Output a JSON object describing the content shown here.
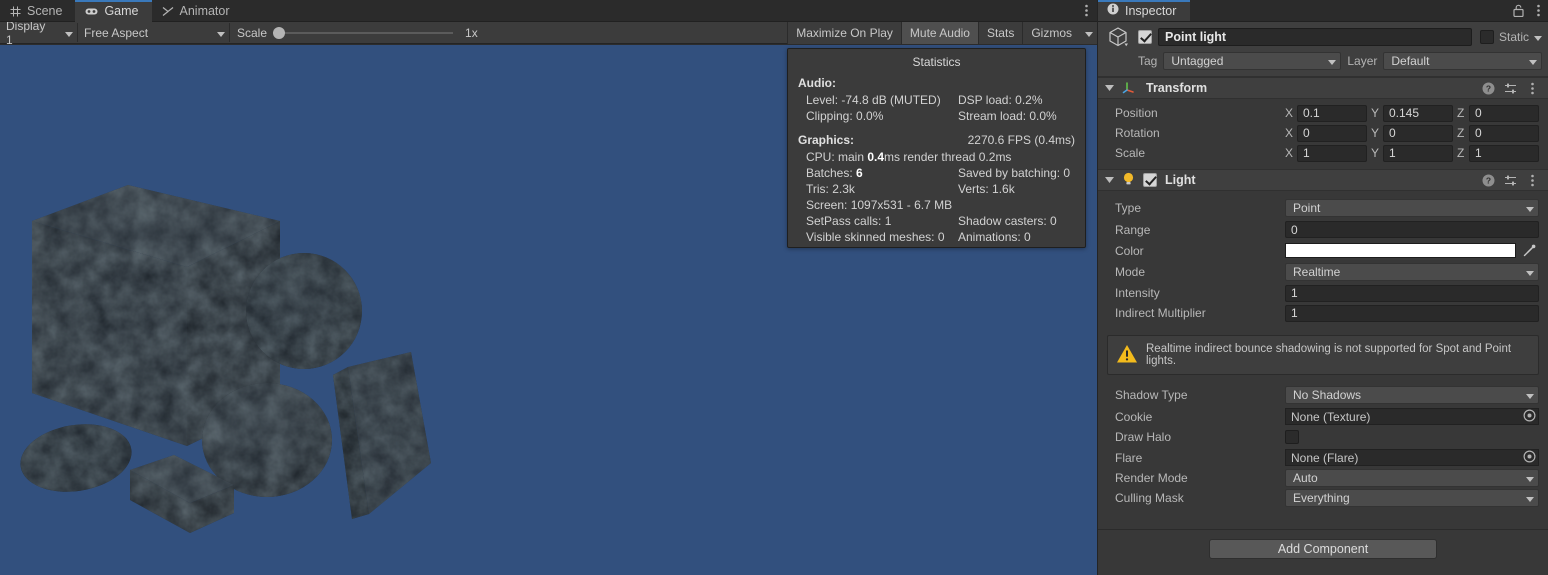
{
  "gameview": {
    "tabs": [
      {
        "label": "Scene",
        "icon": "grid-icon",
        "active": false
      },
      {
        "label": "Game",
        "icon": "gamepad-icon",
        "active": true
      },
      {
        "label": "Animator",
        "icon": "animator-icon",
        "active": false
      }
    ],
    "tabbar_menu_icon": "kebab-menu-icon",
    "toolbar": {
      "display": "Display 1",
      "aspect": "Free Aspect",
      "scale_label": "Scale",
      "scale_value": "1x",
      "maximize_on_play": "Maximize On Play",
      "mute_audio": "Mute Audio",
      "stats": "Stats",
      "gizmos": "Gizmos"
    },
    "background_color": "#32507e"
  },
  "statistics": {
    "title": "Statistics",
    "audio_header": "Audio:",
    "audio_rows": [
      {
        "left": "Level: -74.8 dB (MUTED)",
        "right": "DSP load: 0.2%"
      },
      {
        "left": "Clipping: 0.0%",
        "right": "Stream load: 0.0%"
      }
    ],
    "graphics_header": "Graphics:",
    "fps": "2270.6 FPS (0.4ms)",
    "cpu_prefix": "CPU: main ",
    "cpu_bold": "0.4",
    "cpu_suffix": "ms  render thread 0.2ms",
    "batches_prefix": "Batches: ",
    "batches_bold": "6",
    "saved_by_batching": "Saved by batching: 0",
    "tris": "Tris: 2.3k",
    "verts": "Verts: 1.6k",
    "screen": "Screen: 1097x531 - 6.7 MB",
    "setpass": "SetPass calls: 1",
    "shadow_casters": "Shadow casters: 0",
    "skinned_meshes": "Visible skinned meshes: 0",
    "animations": "Animations: 0"
  },
  "inspector": {
    "tab_label": "Inspector",
    "tab_icon": "info-icon",
    "lock_icon": "lock-icon",
    "menu_icon": "kebab-menu-icon",
    "object": {
      "icon": "gameobject-cube-icon",
      "enabled": true,
      "name": "Point light",
      "static_label": "Static",
      "static_checked": false,
      "tag_label": "Tag",
      "tag_value": "Untagged",
      "layer_label": "Layer",
      "layer_value": "Default"
    },
    "transform": {
      "title": "Transform",
      "icon": "transform-axis-icon",
      "rows": [
        {
          "label": "Position",
          "x": "0.1",
          "y": "0.145",
          "z": "0"
        },
        {
          "label": "Rotation",
          "x": "0",
          "y": "0",
          "z": "0"
        },
        {
          "label": "Scale",
          "x": "1",
          "y": "1",
          "z": "1"
        }
      ],
      "axis_labels": {
        "x": "X",
        "y": "Y",
        "z": "Z"
      }
    },
    "light": {
      "title": "Light",
      "icon": "lightbulb-icon",
      "enabled": true,
      "type_label": "Type",
      "type_value": "Point",
      "range_label": "Range",
      "range_value": "0",
      "color_label": "Color",
      "color_value": "#ffffff",
      "eyedropper_icon": "eyedropper-icon",
      "mode_label": "Mode",
      "mode_value": "Realtime",
      "intensity_label": "Intensity",
      "intensity_value": "1",
      "indirect_label": "Indirect Multiplier",
      "indirect_value": "1",
      "warning_icon": "warning-triangle-icon",
      "warning_text": "Realtime indirect bounce shadowing is not supported for Spot and Point lights.",
      "shadow_type_label": "Shadow Type",
      "shadow_type_value": "No Shadows",
      "cookie_label": "Cookie",
      "cookie_value": "None (Texture)",
      "draw_halo_label": "Draw Halo",
      "draw_halo_checked": false,
      "flare_label": "Flare",
      "flare_value": "None (Flare)",
      "render_mode_label": "Render Mode",
      "render_mode_value": "Auto",
      "culling_mask_label": "Culling Mask",
      "culling_mask_value": "Everything",
      "help_icon": "help-circle-icon",
      "preset_icon": "preset-sliders-icon",
      "menu_icon": "kebab-menu-icon"
    },
    "add_component_label": "Add Component"
  }
}
